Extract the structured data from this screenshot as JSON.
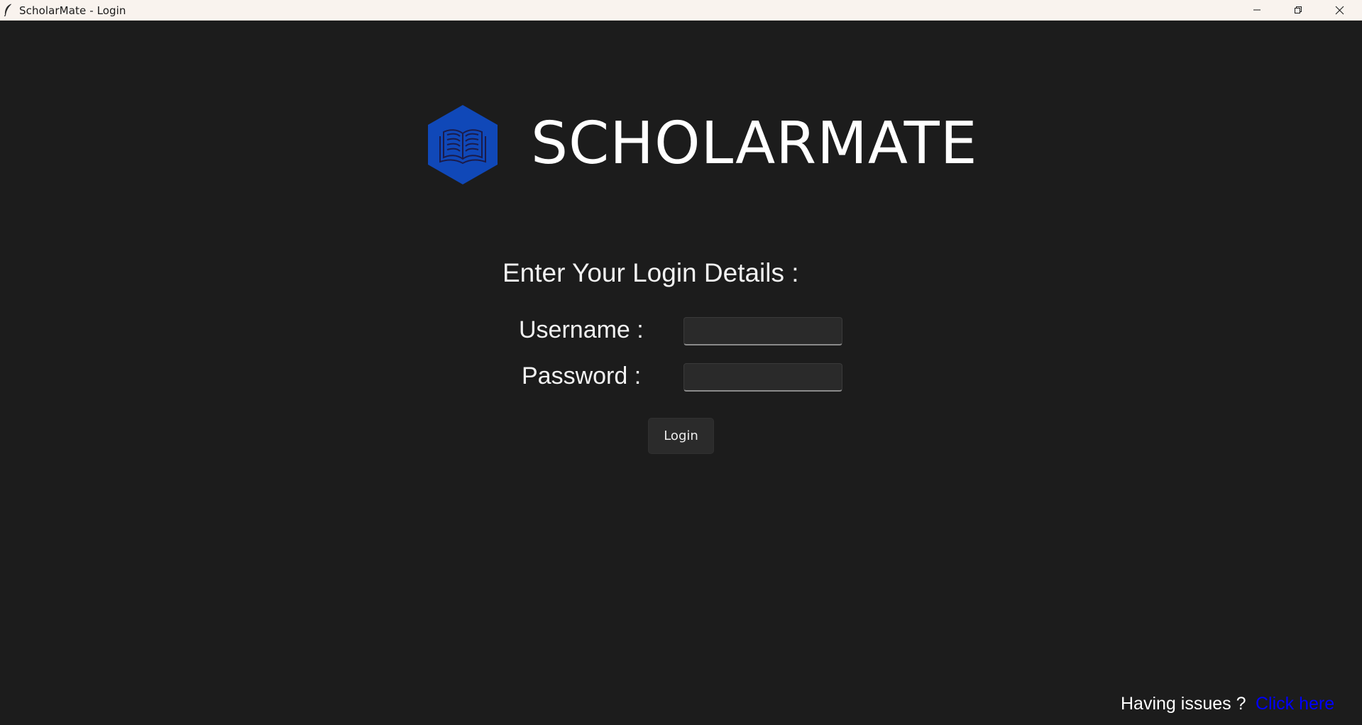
{
  "window": {
    "title": "ScholarMate - Login",
    "controls": {
      "minimize": "minimize-icon",
      "maximize": "restore-icon",
      "close": "close-icon"
    }
  },
  "branding": {
    "name": "SCHOLARMATE",
    "logo_icon": "open-book-icon",
    "logo_color": "#1048b8"
  },
  "form": {
    "heading": "Enter Your Login Details :",
    "username_label": "Username :",
    "password_label": "Password :",
    "username_value": "",
    "password_value": "",
    "login_label": "Login"
  },
  "footer": {
    "issues_text": "Having issues ?",
    "link_text": "Click here",
    "link_color": "#0000ff"
  },
  "colors": {
    "background": "#1c1c1c",
    "titlebar": "#f9f3ee",
    "text": "#ffffff"
  }
}
